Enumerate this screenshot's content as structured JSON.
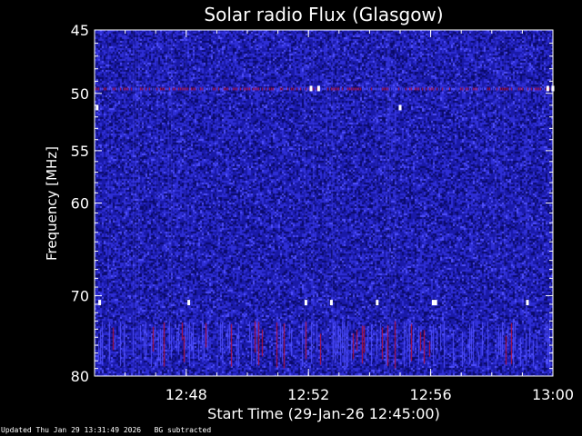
{
  "chart_data": {
    "type": "heatmap",
    "title": "Solar radio Flux (Glasgow)",
    "xlabel": "Start Time (29-Jan-26 12:45:00)",
    "ylabel": "Frequency [MHz]",
    "x_unit": "time (HH:MM, 29-Jan-26)",
    "xlim": [
      "12:45:00",
      "13:00:00"
    ],
    "x_ticks": [
      "12:48",
      "12:52",
      "12:56",
      "13:00"
    ],
    "x_tick_values": [
      "12:48:00",
      "12:52:00",
      "12:56:00",
      "13:00:00"
    ],
    "ylim": [
      45,
      80
    ],
    "y_scale": "log",
    "y_inverted": true,
    "y_ticks": [
      45,
      50,
      55,
      60,
      70,
      80
    ],
    "grid": false,
    "colormap": [
      "#0a0a6a",
      "#1a1aa8",
      "#2e2ed6",
      "#5050ff",
      "#c01030"
    ],
    "background_color": "#2020b0",
    "bright_spots": [
      {
        "time": "12:45:05",
        "freq": 51.2
      },
      {
        "time": "12:52:05",
        "freq": 49.6
      },
      {
        "time": "12:52:20",
        "freq": 49.6
      },
      {
        "time": "12:55:00",
        "freq": 51.2
      },
      {
        "time": "12:59:50",
        "freq": 49.6
      },
      {
        "time": "13:00:00",
        "freq": 49.6
      },
      {
        "time": "12:45:10",
        "freq": 70.8
      },
      {
        "time": "12:48:05",
        "freq": 70.8
      },
      {
        "time": "12:51:55",
        "freq": 70.8
      },
      {
        "time": "12:52:45",
        "freq": 70.8
      },
      {
        "time": "12:54:15",
        "freq": 70.8
      },
      {
        "time": "12:56:05",
        "freq": 70.8
      },
      {
        "time": "12:56:10",
        "freq": 70.8
      },
      {
        "time": "12:59:10",
        "freq": 70.8
      }
    ],
    "interference_band": {
      "freq_range": [
        73,
        79
      ],
      "color": "#c01030"
    },
    "emission_line_freq": 49.6
  },
  "footer": {
    "updated": "Updated Thu Jan 29 13:31:49 2026",
    "bg_note": "BG subtracted"
  }
}
